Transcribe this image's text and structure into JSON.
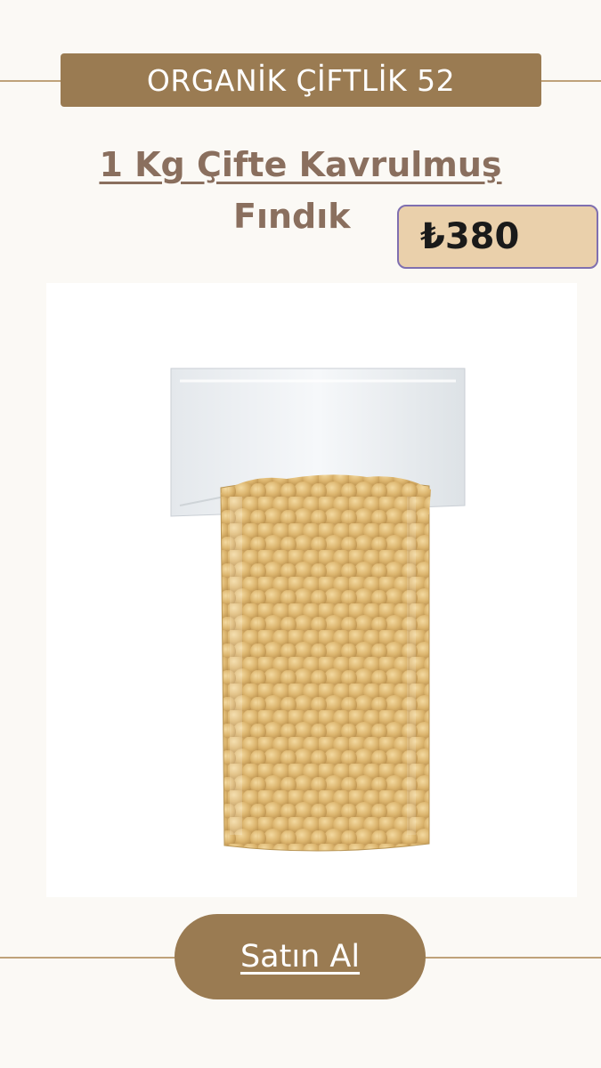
{
  "brand": {
    "name": "ORGANİK ÇİFTLİK 52"
  },
  "product": {
    "title_line1": "1 Kg Çifte Kavrulmuş",
    "title_line2": "Fındık",
    "price": "₺380",
    "image_icon": "hazelnut-bag-icon"
  },
  "actions": {
    "buy_label": "Satın Al"
  },
  "colors": {
    "background": "#fbf9f5",
    "accent_brown": "#9a7b52",
    "title_text": "#8a6f5e",
    "price_bg": "#ead0ab",
    "price_border": "#7f6fb0",
    "divider": "#bfa27a"
  }
}
